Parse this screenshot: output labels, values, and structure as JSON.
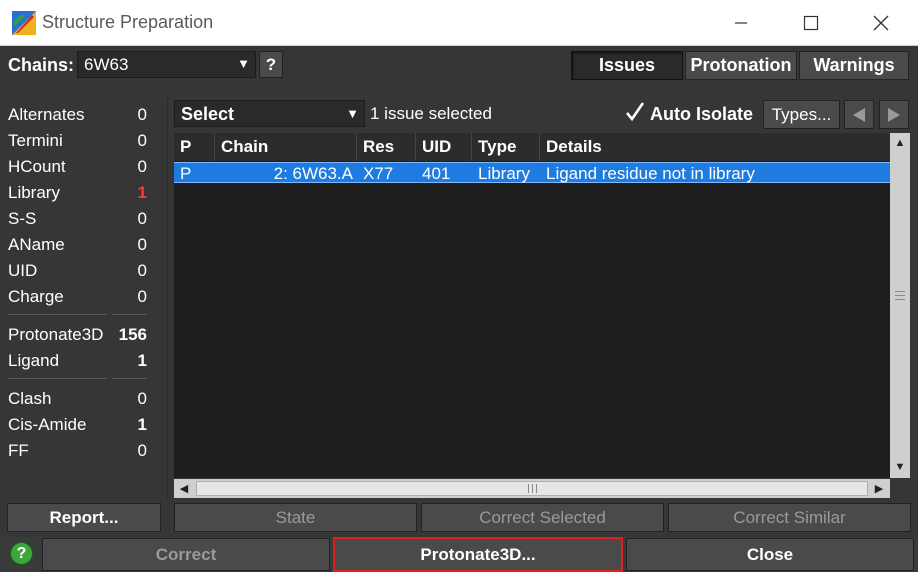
{
  "window": {
    "title": "Structure Preparation"
  },
  "chains": {
    "label": "Chains:",
    "value": "6W63",
    "help": "?"
  },
  "tabs": [
    {
      "label": "Issues"
    },
    {
      "label": "Protonation"
    },
    {
      "label": "Warnings"
    }
  ],
  "stats": {
    "group1": [
      {
        "label": "Alternates",
        "value": "0"
      },
      {
        "label": "Termini",
        "value": "0"
      },
      {
        "label": "HCount",
        "value": "0"
      },
      {
        "label": "Library",
        "value": "1"
      },
      {
        "label": "S-S",
        "value": "0"
      },
      {
        "label": "AName",
        "value": "0"
      },
      {
        "label": "UID",
        "value": "0"
      },
      {
        "label": "Charge",
        "value": "0"
      }
    ],
    "group2": [
      {
        "label": "Protonate3D",
        "value": "156"
      },
      {
        "label": "Ligand",
        "value": "1"
      }
    ],
    "group3": [
      {
        "label": "Clash",
        "value": "0"
      },
      {
        "label": "Cis-Amide",
        "value": "1"
      },
      {
        "label": "FF",
        "value": "0"
      }
    ],
    "highlight_color": "#ff3b30"
  },
  "filter": {
    "value": "Select",
    "status": "1 issue selected"
  },
  "auto_isolate": {
    "label": "Auto Isolate",
    "checked": true
  },
  "types_button": "Types...",
  "table": {
    "columns": [
      "P",
      "Chain",
      "Res",
      "UID",
      "Type",
      "Details"
    ],
    "rows": [
      {
        "p": "P",
        "chain": "2: 6W63.A",
        "res": "X77",
        "uid": "401",
        "type": "Library",
        "details": "Ligand residue not in library",
        "selected": true
      }
    ]
  },
  "buttons": {
    "report": "Report...",
    "state": "State",
    "correct_selected": "Correct Selected",
    "correct_similar": "Correct Similar",
    "correct": "Correct",
    "protonate": "Protonate3D...",
    "close": "Close"
  },
  "colors": {
    "accent": "#1e7be0",
    "help_green": "#3ea63e",
    "highlight_border": "#e02020"
  }
}
